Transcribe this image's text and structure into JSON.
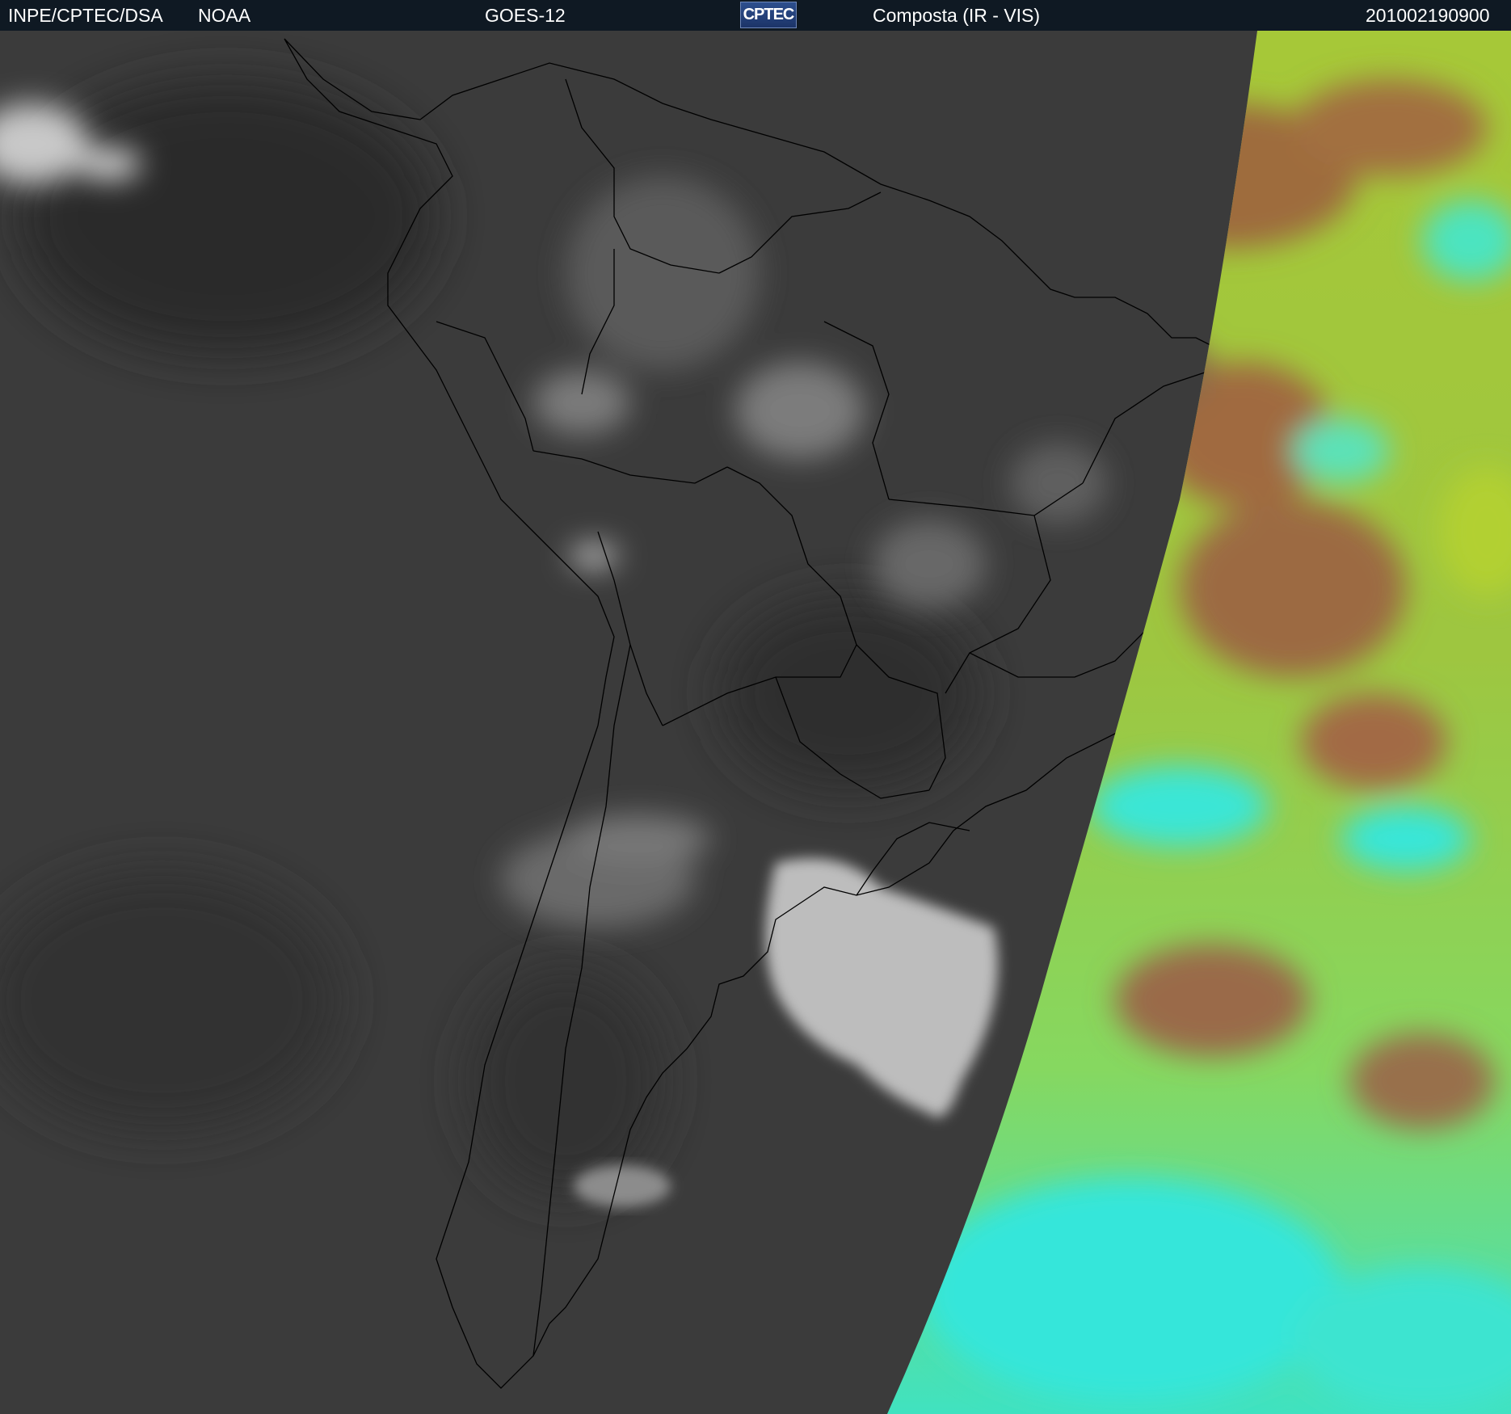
{
  "header": {
    "institution": "INPE/CPTEC/DSA",
    "agency": "NOAA",
    "satellite": "GOES-12",
    "logo_text": "CPTEC",
    "product": "Composta (IR - VIS)",
    "timestamp": "201002190900"
  },
  "colors": {
    "header_bg": "#0f1923",
    "header_text": "#ffffff",
    "ir_background": "#3a3a3a",
    "ir_cloud": "#9a9a9a",
    "vis_yellow_green": "#a8d838",
    "vis_brown": "#9a6a40",
    "vis_cyan": "#30e8d8",
    "border_lines": "#000000"
  },
  "icons": {
    "logo": "cptec-logo"
  }
}
